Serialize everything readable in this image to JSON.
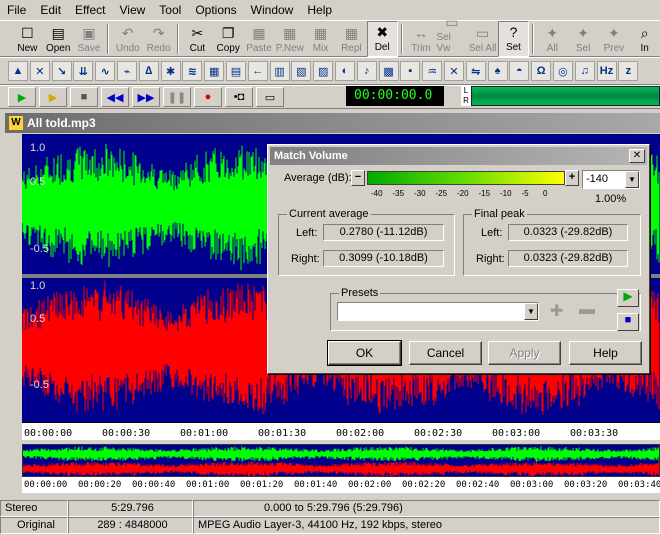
{
  "menu": [
    "File",
    "Edit",
    "Effect",
    "View",
    "Tool",
    "Options",
    "Window",
    "Help"
  ],
  "toolbar": [
    {
      "label": "New",
      "icon": "new-file-icon",
      "glyph": "☐",
      "state": "normal"
    },
    {
      "label": "Open",
      "icon": "open-folder-icon",
      "glyph": "▤",
      "state": "normal"
    },
    {
      "label": "Save",
      "icon": "save-disk-icon",
      "glyph": "▣",
      "state": "disabled"
    },
    {
      "label": "Undo",
      "icon": "undo-icon",
      "glyph": "↶",
      "state": "disabled"
    },
    {
      "label": "Redo",
      "icon": "redo-icon",
      "glyph": "↷",
      "state": "disabled"
    },
    {
      "label": "Cut",
      "icon": "scissors-icon",
      "glyph": "✂",
      "state": "normal"
    },
    {
      "label": "Copy",
      "icon": "copy-icon",
      "glyph": "❐",
      "state": "normal"
    },
    {
      "label": "Paste",
      "icon": "paste-icon",
      "glyph": "▦",
      "state": "disabled"
    },
    {
      "label": "P.New",
      "icon": "paste-new-icon",
      "glyph": "▦",
      "state": "disabled"
    },
    {
      "label": "Mix",
      "icon": "mix-icon",
      "glyph": "▦",
      "state": "disabled"
    },
    {
      "label": "Repl",
      "icon": "replace-icon",
      "glyph": "▦",
      "state": "disabled"
    },
    {
      "label": "Del",
      "icon": "delete-icon",
      "glyph": "✖",
      "state": "pressed"
    },
    {
      "label": "Trim",
      "icon": "trim-icon",
      "glyph": "↔",
      "state": "disabled"
    },
    {
      "label": "Sel Vw",
      "icon": "select-view-icon",
      "glyph": "▭",
      "state": "disabled"
    },
    {
      "label": "Sel All",
      "icon": "select-all-icon",
      "glyph": "▭",
      "state": "disabled"
    },
    {
      "label": "Set",
      "icon": "set-marker-icon",
      "glyph": "?",
      "state": "pressed"
    },
    {
      "label": "All",
      "icon": "zoom-all-icon",
      "glyph": "✦",
      "state": "disabled"
    },
    {
      "label": "Sel",
      "icon": "zoom-selection-icon",
      "glyph": "✦",
      "state": "disabled"
    },
    {
      "label": "Prev",
      "icon": "zoom-previous-icon",
      "glyph": "✦",
      "state": "disabled"
    },
    {
      "label": "In",
      "icon": "zoom-in-icon",
      "glyph": "⌕",
      "state": "normal"
    }
  ],
  "toolbar2_icons": [
    "amplify-icon",
    "cross-fade-icon",
    "invert-icon",
    "dc-offset-icon",
    "envelope-icon",
    "fade-in-icon",
    "fade-out-icon",
    "filter-icon",
    "flanger-icon",
    "graphic-eq-icon",
    "gap-icon",
    "insert-silence-icon",
    "markers-icon",
    "noise-gate-icon",
    "normalize-icon",
    "pan-icon",
    "pitch-icon",
    "resample-icon",
    "reverse-icon",
    "tempo-icon",
    "vibrato-icon",
    "distortion-icon",
    "echo-icon",
    "chorus-icon",
    "compressor-icon",
    "delay-icon",
    "eq-icon",
    "hz-icon",
    "freq-analysis-icon"
  ],
  "transport": {
    "buttons": [
      "play-icon",
      "play-loop-icon",
      "stop-icon",
      "rewind-icon",
      "fast-forward-icon",
      "pause-icon",
      "record-icon",
      "loop-icon",
      "selection-icon"
    ],
    "time": "00:00:00.0",
    "lr_label": "L\nR"
  },
  "window_title": "All told.mp3",
  "y_labels_top": [
    "1.0",
    "0.5",
    "-0.5"
  ],
  "y_labels_bottom": [
    "1.0",
    "0.5",
    "-0.5"
  ],
  "timeline": [
    "00:00:00",
    "00:00:30",
    "00:01:00",
    "00:01:30",
    "00:02:00",
    "00:02:30",
    "00:03:00",
    "00:03:30"
  ],
  "overview_timeline": [
    "00:00:00",
    "00:00:20",
    "00:00:40",
    "00:01:00",
    "00:01:20",
    "00:01:40",
    "00:02:00",
    "00:02:20",
    "00:02:40",
    "00:03:00",
    "00:03:20",
    "00:03:40"
  ],
  "status": {
    "row1": [
      "Stereo",
      "5:29.796",
      "0.000 to 5:29.796 (5:29.796)"
    ],
    "row2": [
      "Original",
      "289 : 4848000",
      "MPEG Audio Layer-3, 44100 Hz, 192 kbps, stereo"
    ]
  },
  "dialog": {
    "title": "Match Volume",
    "average_label": "Average (dB):",
    "scale": [
      "-40",
      "-35",
      "-30",
      "-25",
      "-20",
      "-15",
      "-10",
      "-5",
      "0"
    ],
    "average_value": "-140",
    "percent": "1.00%",
    "current_average": {
      "title": "Current average",
      "left_label": "Left:",
      "left_value": "0.2780 (-11.12dB)",
      "right_label": "Right:",
      "right_value": "0.3099 (-10.18dB)"
    },
    "final_peak": {
      "title": "Final peak",
      "left_label": "Left:",
      "left_value": "0.0323 (-29.82dB)",
      "right_label": "Right:",
      "right_value": "0.0323 (-29.82dB)"
    },
    "presets_label": "Presets",
    "presets_value": "",
    "buttons": {
      "ok": "OK",
      "cancel": "Cancel",
      "apply": "Apply",
      "help": "Help"
    }
  }
}
